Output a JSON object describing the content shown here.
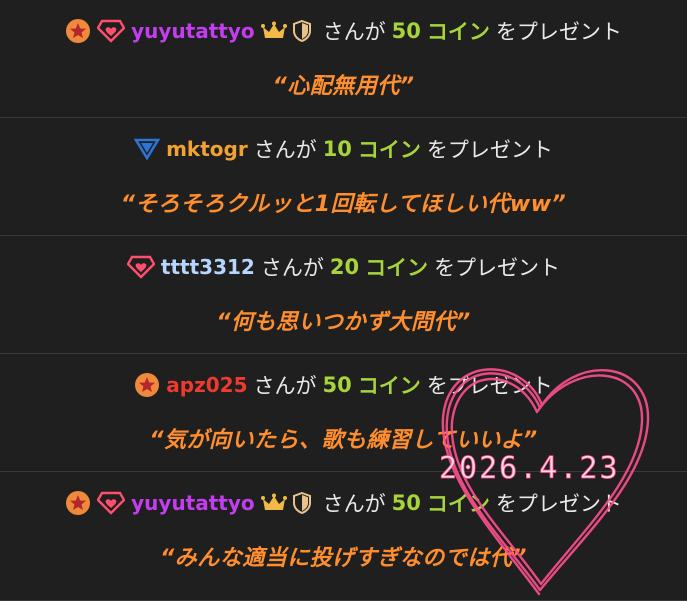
{
  "entries": [
    {
      "user": "yuyutattyo",
      "amount": "50",
      "coin_word": "コイン",
      "suffix_ga": "さんが",
      "suffix_present": "をプレゼント",
      "message": "“心配無用代”"
    },
    {
      "user": "mktogr",
      "amount": "10",
      "coin_word": "コイン",
      "suffix_ga": "さんが",
      "suffix_present": "をプレゼント",
      "message": "“そろそろクルッと1回転してほしい代ww”"
    },
    {
      "user": "tttt3312",
      "amount": "20",
      "coin_word": "コイン",
      "suffix_ga": "さんが",
      "suffix_present": "をプレゼント",
      "message": "“何も思いつかず大問代”"
    },
    {
      "user": "apz025",
      "amount": "50",
      "coin_word": "コイン",
      "suffix_ga": "さんが",
      "suffix_present": "をプレゼント",
      "message": "“気が向いたら、歌も練習していいよ”"
    },
    {
      "user": "yuyutattyo",
      "amount": "50",
      "coin_word": "コイン",
      "suffix_ga": "さんが",
      "suffix_present": "をプレゼント",
      "message": "“みんな適当に投げすぎなのでは代”"
    }
  ],
  "handwritten_date": "2026.4.23",
  "colors": {
    "background": "#1f1f1f",
    "message": "#ff8e2e",
    "coin": "#a6d43a",
    "heart_doodle": "#ff4f8f",
    "user_purple": "#c53df0",
    "user_orange": "#f0a233",
    "user_lightblue": "#b7d6ff",
    "user_red": "#ef3b2e"
  },
  "icons": [
    "star-badge-icon",
    "diamond-heart-icon",
    "crown-icon",
    "shield-icon",
    "triangle-badge-icon"
  ]
}
